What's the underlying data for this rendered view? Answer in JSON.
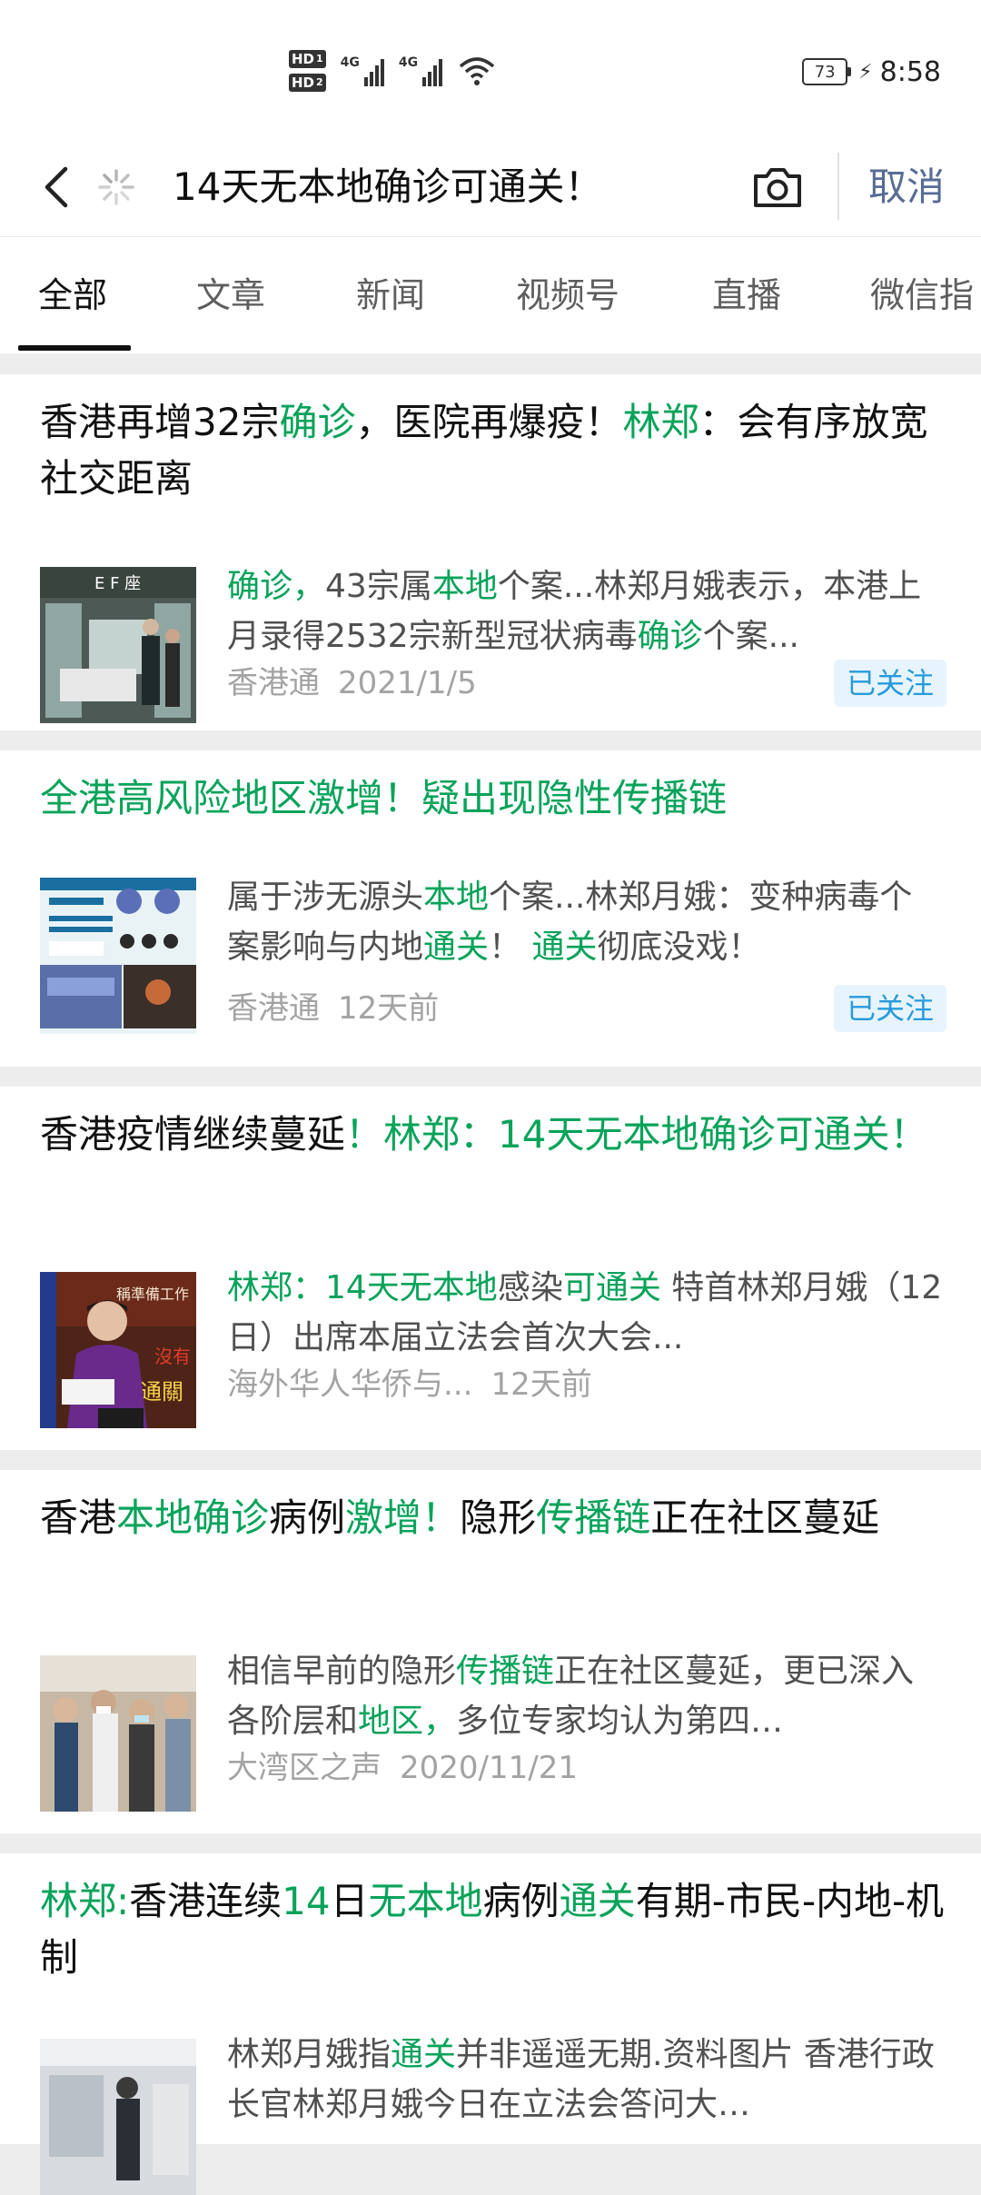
{
  "status_bar": {
    "hd1": "HD",
    "hd1_sub": "1",
    "hd2": "HD",
    "hd2_sub": "2",
    "net1": "4G",
    "net2": "4G",
    "battery": "73",
    "time": "8:58"
  },
  "search": {
    "query": "14天无本地确诊可通关！",
    "cancel_label": "取消"
  },
  "tabs": [
    {
      "label": "全部"
    },
    {
      "label": "文章"
    },
    {
      "label": "新闻"
    },
    {
      "label": "视频号"
    },
    {
      "label": "直播"
    },
    {
      "label": "微信指"
    }
  ],
  "results": [
    {
      "title": [
        {
          "t": "香港再增32宗",
          "hl": false
        },
        {
          "t": "确诊",
          "hl": true
        },
        {
          "t": "，医院再爆疫！",
          "hl": false
        },
        {
          "t": "林郑",
          "hl": true
        },
        {
          "t": "：会有序放宽社交距离",
          "hl": false
        }
      ],
      "snippet": [
        {
          "t": "确诊，",
          "hl": true
        },
        {
          "t": "43宗属",
          "hl": false
        },
        {
          "t": "本地",
          "hl": true
        },
        {
          "t": "个案...林郑月娥表示，本港上月录得2532宗新型冠状病毒",
          "hl": false
        },
        {
          "t": "确诊",
          "hl": true
        },
        {
          "t": "个案...",
          "hl": false
        }
      ],
      "source": "香港通",
      "date": "2021/1/5",
      "badge": "已关注",
      "thumb": "hospital"
    },
    {
      "title": [
        {
          "t": "全港高风险地区激增！疑出现隐性传播链",
          "hl": true
        }
      ],
      "snippet": [
        {
          "t": "属于涉无源头",
          "hl": false
        },
        {
          "t": "本地",
          "hl": true
        },
        {
          "t": "个案...林郑月娥：变种病毒个案影响与内地",
          "hl": false
        },
        {
          "t": "通关",
          "hl": true
        },
        {
          "t": "！ ",
          "hl": false
        },
        {
          "t": "通关",
          "hl": true
        },
        {
          "t": "彻底没戏！",
          "hl": false
        }
      ],
      "source": "香港通",
      "date": "12天前",
      "badge": "已关注",
      "thumb": "infographic"
    },
    {
      "title": [
        {
          "t": "香港疫情继续蔓延",
          "hl": false
        },
        {
          "t": "！林郑：14天无本地确诊可通关！",
          "hl": true
        }
      ],
      "snippet": [
        {
          "t": "林郑：14天无本地",
          "hl": true
        },
        {
          "t": "感染",
          "hl": false
        },
        {
          "t": "可通关",
          "hl": true
        },
        {
          "t": " 特首林郑月娥（12日）出席本届立法会首次大会...",
          "hl": false
        }
      ],
      "source": "海外华人华侨与...",
      "date": "12天前",
      "badge": "",
      "thumb": "speaker",
      "thumb_text_1": "稱準備工作",
      "thumb_text_2": "沒有",
      "thumb_text_3": "通關"
    },
    {
      "title": [
        {
          "t": "香港",
          "hl": false
        },
        {
          "t": "本地确诊",
          "hl": true
        },
        {
          "t": "病例",
          "hl": false
        },
        {
          "t": "激增！",
          "hl": true
        },
        {
          "t": "隐形",
          "hl": false
        },
        {
          "t": "传播链",
          "hl": true
        },
        {
          "t": "正在社区蔓延",
          "hl": false
        }
      ],
      "snippet": [
        {
          "t": "相信早前的隐形",
          "hl": false
        },
        {
          "t": "传播链",
          "hl": true
        },
        {
          "t": "正在社区蔓延，更已深入各阶层和",
          "hl": false
        },
        {
          "t": "地区，",
          "hl": true
        },
        {
          "t": "多位专家均认为第四…",
          "hl": false
        }
      ],
      "source": "大湾区之声",
      "date": "2020/11/21",
      "badge": "",
      "thumb": "crowd"
    },
    {
      "title": [
        {
          "t": "林郑:",
          "hl": true
        },
        {
          "t": "香港连续",
          "hl": false
        },
        {
          "t": "14",
          "hl": true
        },
        {
          "t": "日",
          "hl": false
        },
        {
          "t": "无本地",
          "hl": true
        },
        {
          "t": "病例",
          "hl": false
        },
        {
          "t": "通关",
          "hl": true
        },
        {
          "t": "有期-市民-内地-机制",
          "hl": false
        }
      ],
      "snippet": [
        {
          "t": "林郑月娥指",
          "hl": false
        },
        {
          "t": "通关",
          "hl": true
        },
        {
          "t": "并非遥遥无期.资料图片 香港行政长官林郑月娥今日在立法会答问大…",
          "hl": false
        }
      ],
      "source": "",
      "date": "",
      "badge": "",
      "thumb": "airport"
    }
  ]
}
